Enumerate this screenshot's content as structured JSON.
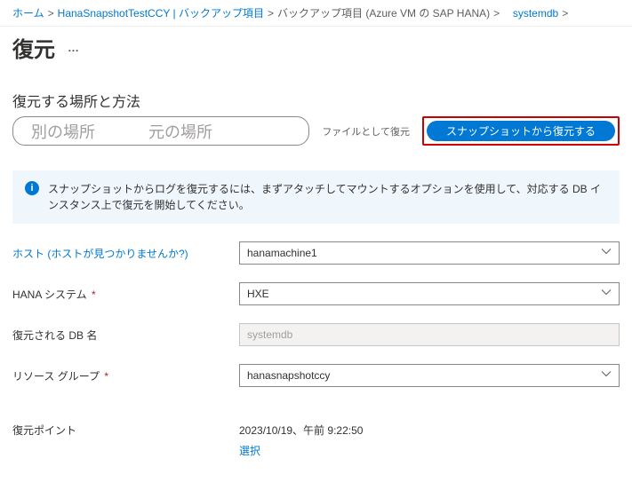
{
  "breadcrumb": {
    "home": "ホーム",
    "recovery_vault": "HanaSnapshotTestCCY | バックアップ項目",
    "backup_items": "バックアップ項目 (Azure VM の SAP HANA)",
    "db": "systemdb",
    "sep": ">"
  },
  "page": {
    "title": "復元",
    "more": "…"
  },
  "section": {
    "heading": "復元する場所と方法"
  },
  "tabs": {
    "alt_location": "別の場所",
    "orig_location": "元の場所",
    "as_files": "ファイルとして復元",
    "from_snapshot": "スナップショットから復元する"
  },
  "info": {
    "text": "スナップショットからログを復元するには、まずアタッチしてマウントするオプションを使用して、対応する DB インスタンス上で復元を開始してください。"
  },
  "form": {
    "host_label": "ホスト",
    "host_help": "(ホストが見つかりませんか?)",
    "host_value": "hanamachine1",
    "hana_label": "HANA システム",
    "hana_value": "HXE",
    "restored_db_label": "復元される DB 名",
    "restored_db_value": "systemdb",
    "rg_label": "リソース グループ",
    "rg_value": "hanasnapshotccy"
  },
  "restore_point": {
    "label": "復元ポイント",
    "value": "2023/10/19、午前 9:22:50",
    "select": "選択"
  }
}
